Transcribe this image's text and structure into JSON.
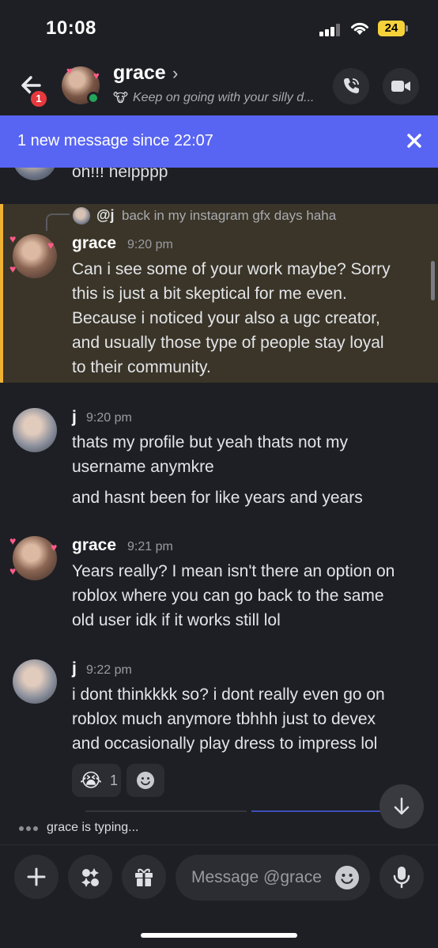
{
  "status_bar": {
    "time": "10:08",
    "battery": "24"
  },
  "header": {
    "back_badge": "1",
    "name": "grace",
    "chevron": "›",
    "status_icon": "🐮",
    "status_text": "Keep on going with your silly d...",
    "icons": {
      "back": "arrow-left-icon",
      "call": "phone-icon",
      "video": "video-camera-icon"
    }
  },
  "banner": {
    "text": "1 new message since 22:07",
    "close": "×"
  },
  "messages": {
    "partial_text": "oh!!! helpppp",
    "reply": {
      "user": "@j",
      "text": "back in my instagram gfx days haha"
    },
    "m1": {
      "user": "grace",
      "time": "9:20 pm",
      "lines": [
        "Can i see some of your work maybe? Sorry",
        "this is just a bit skeptical for me even.",
        "Because i noticed your also a ugc creator,",
        "and usually those type of people stay loyal",
        "to their community."
      ]
    },
    "m2": {
      "user": "j",
      "time": "9:20 pm",
      "lines": [
        "thats my profile but yeah thats not my",
        "username anymkre"
      ],
      "extra": "and hasnt been for like years and years"
    },
    "m3": {
      "user": "grace",
      "time": "9:21 pm",
      "lines": [
        "Years really? I mean isn't there an option on",
        "roblox where you can go back to the same",
        "old user idk if it works still lol"
      ]
    },
    "m4": {
      "user": "j",
      "time": "9:22 pm",
      "lines": [
        "i dont thinkkkk so? i dont really even go on",
        "roblox much anymore tbhhh just to devex",
        "and occasionally play dress to impress lol"
      ]
    },
    "reaction": {
      "emoji": "😭",
      "count": "1"
    }
  },
  "typing": {
    "text": "grace is typing..."
  },
  "composer": {
    "placeholder": "Message @grace",
    "icons": [
      "plus-icon",
      "apps-icon",
      "gift-icon",
      "emoji-icon",
      "microphone-icon"
    ]
  },
  "colors": {
    "blurple": "#5865f2",
    "highlight_bg": "#3a3528",
    "highlight_bar": "#f0b232",
    "online": "#23a55a",
    "badge": "#e5393e"
  }
}
